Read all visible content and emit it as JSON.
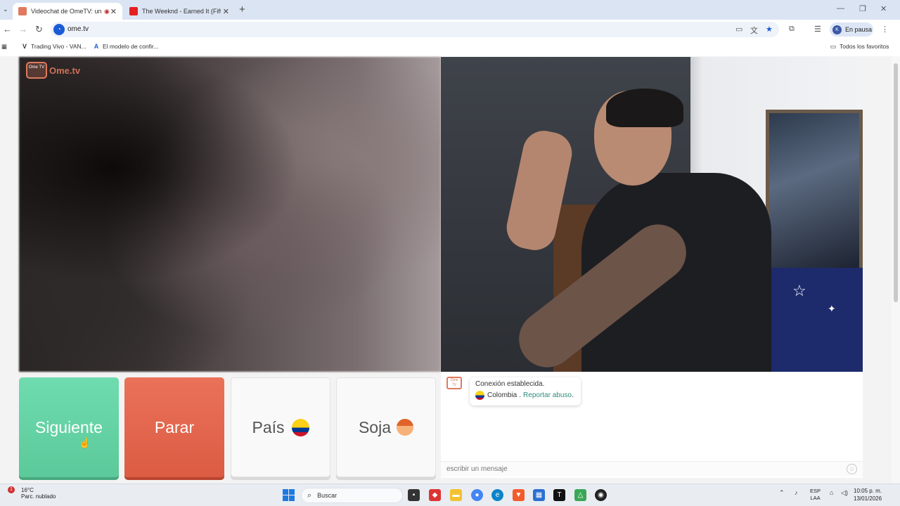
{
  "browser": {
    "tabs": [
      {
        "title": "Videochat de OmeTV: una",
        "active": true
      },
      {
        "title": "The Weeknd - Earned It (Fifty S",
        "active": false
      }
    ],
    "address": "ome.tv",
    "profile_initial": "K",
    "profile_label": "En pausa",
    "bookmarks": [
      {
        "label": "Trading Vivo - VAN..."
      },
      {
        "label": "El modelo de confir..."
      }
    ],
    "favorites_label": "Todos los favoritos"
  },
  "page": {
    "logo_text": "Ome.tv",
    "logo_badge": "Ome TV",
    "buttons": {
      "next": "Siguiente",
      "stop": "Parar",
      "country": "País",
      "gender": "Soja"
    },
    "chat": {
      "status": "Conexión establecida.",
      "country": "Colombia",
      "separator": ".",
      "report_link": "Reportar abuso",
      "report_suffix": ".",
      "input_placeholder": "escribir un mensaje"
    }
  },
  "taskbar": {
    "weather_temp": "16°C",
    "weather_desc": "Parc. nublado",
    "weather_badge": "1",
    "search_label": "Buscar",
    "lang_line1": "ESP",
    "lang_line2": "LAA",
    "time": "10:05 p. m.",
    "date": "13/01/2026"
  },
  "colors": {
    "next": "#5bc99a",
    "stop": "#dc5b43",
    "brand": "#e07a5f",
    "link": "#2e8b7a"
  }
}
